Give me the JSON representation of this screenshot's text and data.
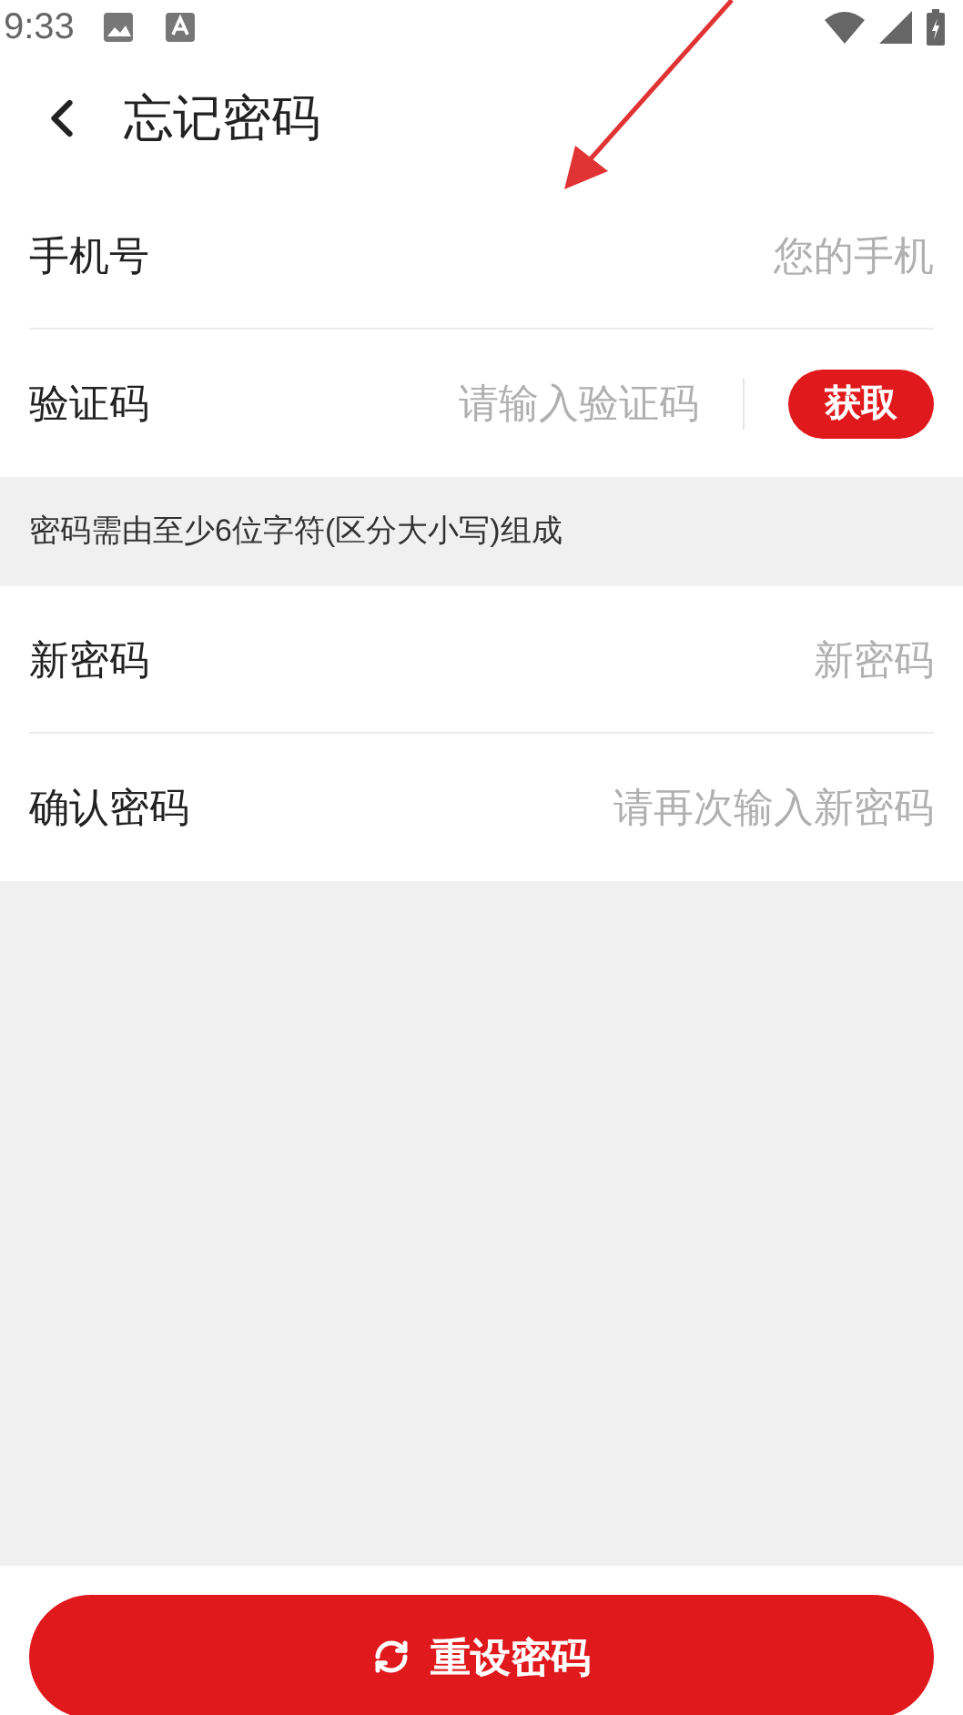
{
  "status_bar": {
    "time": "9:33"
  },
  "header": {
    "title": "忘记密码"
  },
  "fields": [
    {
      "kind": "input",
      "label": "手机号",
      "placeholder": "您的手机"
    },
    {
      "kind": "code",
      "label": "验证码",
      "placeholder": "请输入验证码",
      "button": "获取"
    }
  ],
  "hint": "密码需由至少6位字符(区分大小写)组成",
  "password_fields": [
    {
      "kind": "input",
      "label": "新密码",
      "placeholder": "新密码"
    },
    {
      "kind": "input",
      "label": "确认密码",
      "placeholder": "请再次输入新密码"
    }
  ],
  "submit_button": "重设密码"
}
